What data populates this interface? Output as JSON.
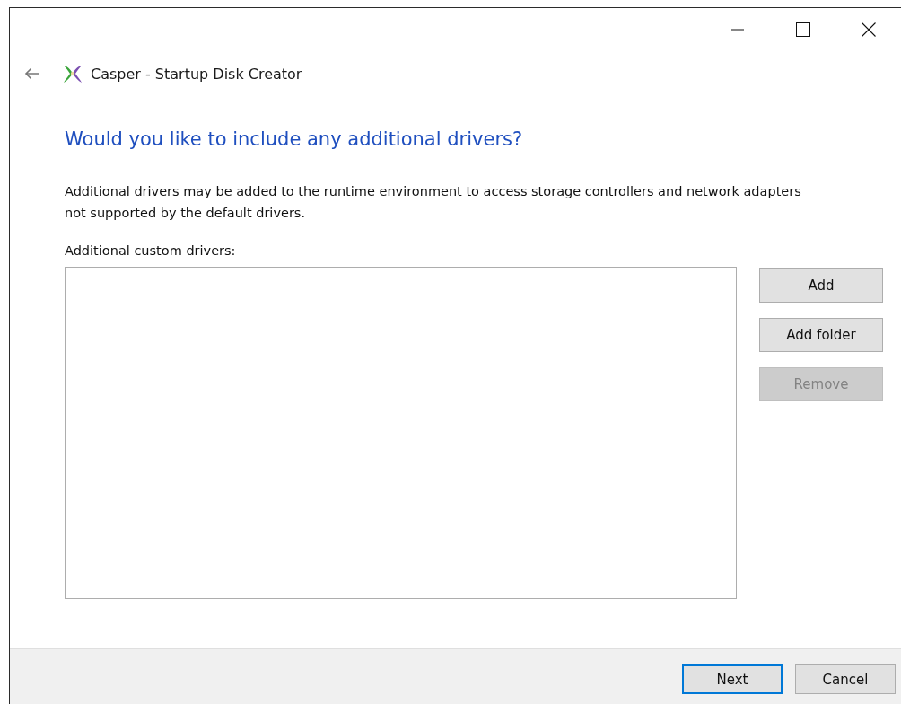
{
  "window": {
    "title": "Casper - Startup Disk Creator",
    "controls": [
      {
        "kind": "minimize"
      },
      {
        "kind": "maximize"
      },
      {
        "kind": "close"
      }
    ]
  },
  "heading": "Would you like to include any additional drivers?",
  "description": "Additional drivers may be added to the runtime environment to access storage controllers and network adapters not supported by the default drivers.",
  "drivers_list": {
    "label": "Additional custom drivers:"
  },
  "side_buttons": [
    {
      "label": "Add",
      "disabled": false
    },
    {
      "label": "Add folder",
      "disabled": false
    },
    {
      "label": "Remove",
      "disabled": true
    }
  ],
  "footer_buttons": [
    {
      "label": "Next",
      "focused": true
    },
    {
      "label": "Cancel",
      "focused": false
    }
  ]
}
